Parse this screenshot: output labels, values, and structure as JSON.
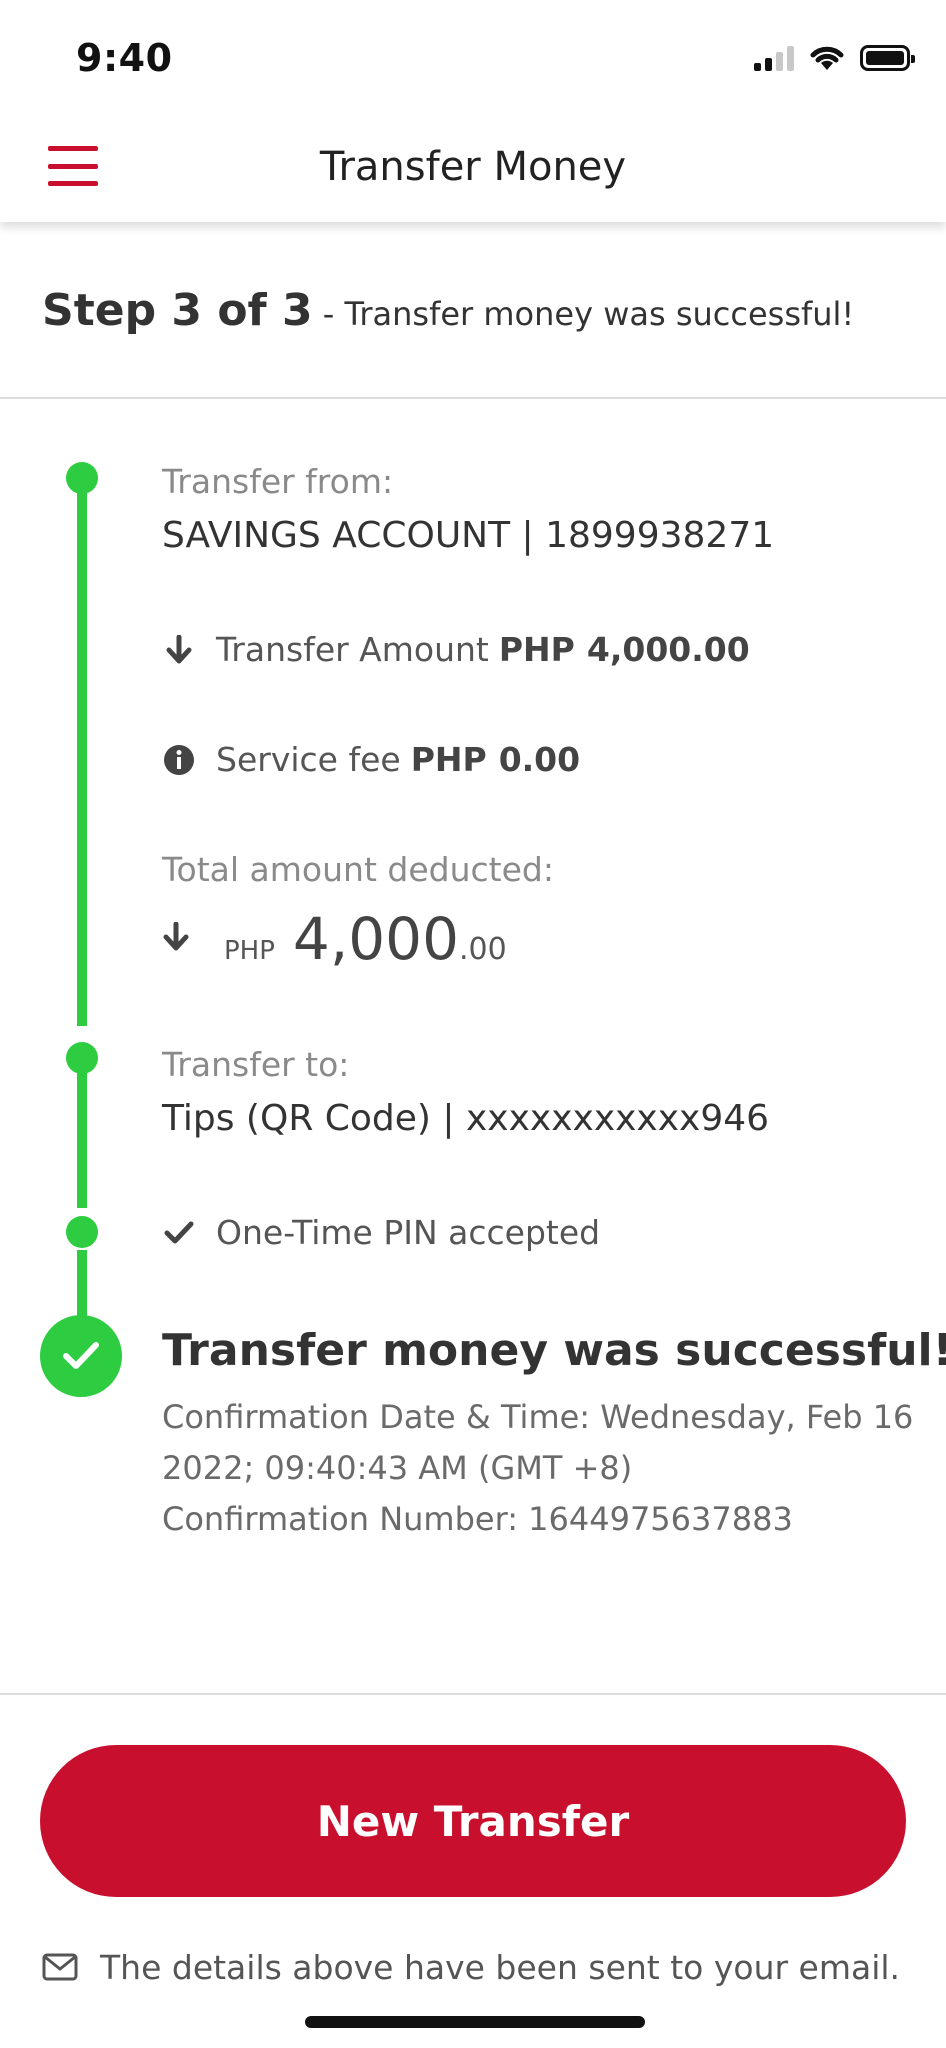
{
  "status_bar": {
    "time": "9:40",
    "signal_icon": "cellular-signal-icon",
    "wifi_icon": "wifi-icon",
    "battery_icon": "battery-icon"
  },
  "header": {
    "menu_icon": "hamburger-menu-icon",
    "title": "Transfer Money"
  },
  "step": {
    "label": "Step 3 of 3",
    "separator": " - ",
    "description": "Transfer money was successful!"
  },
  "transfer_from": {
    "label": "Transfer from:",
    "value": "SAVINGS ACCOUNT | 1899938271"
  },
  "transfer_amount": {
    "icon": "arrow-down-icon",
    "label": "Transfer Amount",
    "currency": "PHP",
    "amount": "4,000.00"
  },
  "service_fee": {
    "icon": "info-icon",
    "label": "Service fee",
    "currency": "PHP",
    "amount": "0.00"
  },
  "total": {
    "label": "Total amount deducted:",
    "icon": "arrow-down-icon",
    "currency": "PHP",
    "amount_whole": "4,000",
    "amount_decimal": ".00"
  },
  "transfer_to": {
    "label": "Transfer to:",
    "value": "Tips (QR Code) | xxxxxxxxxxx946"
  },
  "otp": {
    "icon": "checkmark-icon",
    "label": "One-Time PIN accepted"
  },
  "result": {
    "icon": "success-check-icon",
    "title": "Transfer money was successful!",
    "confirmation_line1": "Confirmation Date & Time: Wednesday, Feb 16",
    "confirmation_line2": "2022; 09:40:43 AM (GMT +8)",
    "confirmation_line3": "Confirmation Number: 1644975637883"
  },
  "actions": {
    "new_transfer_label": "New Transfer"
  },
  "footer": {
    "email_icon": "envelope-icon",
    "email_note": "The details above have been sent to your email."
  },
  "colors": {
    "brand_red": "#c8102e",
    "success_green": "#2ecc40"
  }
}
